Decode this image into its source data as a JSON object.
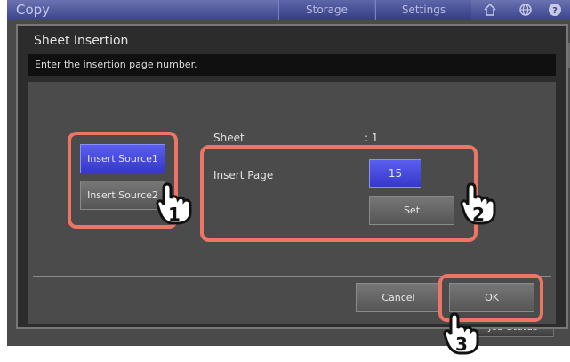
{
  "app": {
    "title": "Copy",
    "tabs": [
      {
        "label": "Storage"
      },
      {
        "label": "Settings"
      }
    ],
    "job_status": "Job Status"
  },
  "dialog": {
    "title": "Sheet Insertion",
    "message": "Enter the insertion page number.",
    "source_buttons": [
      {
        "label": "Insert Source1",
        "selected": true
      },
      {
        "label": "Insert Source2",
        "selected": false
      }
    ],
    "sheet_label": "Sheet",
    "sheet_value": ": 1",
    "insert_page_label": "Insert Page",
    "insert_page_value": "15",
    "set_label": "Set",
    "cancel_label": "Cancel",
    "ok_label": "OK"
  },
  "steps": [
    "1",
    "2",
    "3"
  ],
  "colors": {
    "callout": "#ee7564",
    "selected_button": "#4a4fe0",
    "topbar": "#4a5299"
  },
  "icons": [
    "home-icon",
    "globe-icon",
    "help-icon",
    "hand-pointer-icon"
  ]
}
